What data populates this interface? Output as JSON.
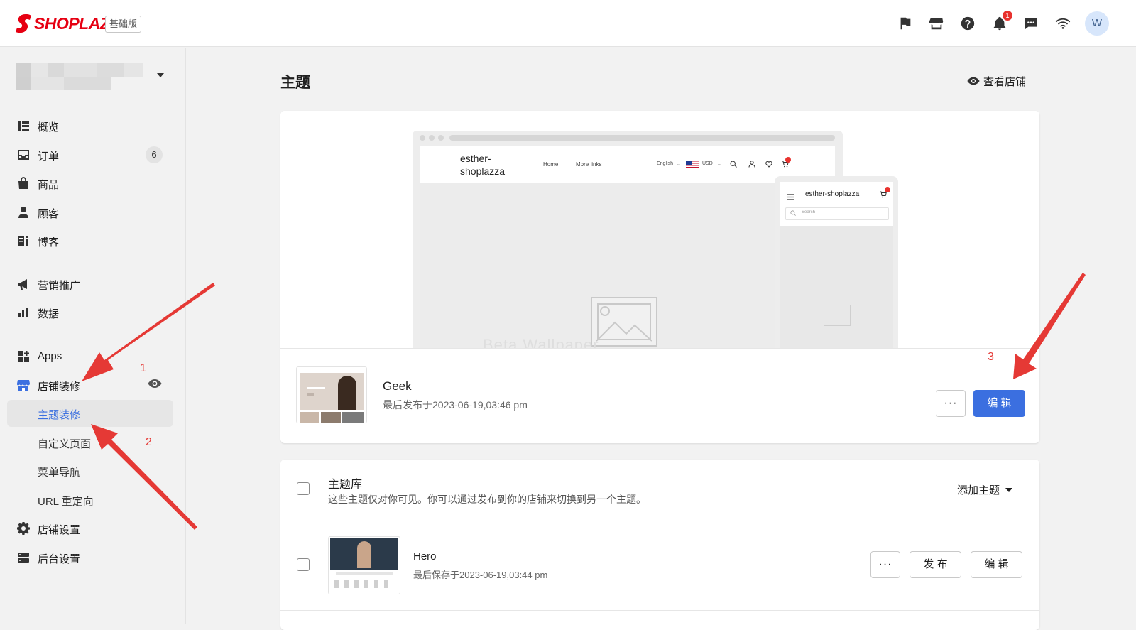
{
  "brand": {
    "name": "SHOPLAZZA",
    "plan": "基础版",
    "accent": "#e60012"
  },
  "topbar": {
    "icons": [
      "flag-icon",
      "store-icon",
      "help-icon",
      "bell-icon",
      "chat-icon",
      "wifi-icon"
    ],
    "notification_count": "1",
    "avatar_initial": "W"
  },
  "sidebar": {
    "store_name": "",
    "items": [
      {
        "label": "概览",
        "icon": "overview-icon"
      },
      {
        "label": "订单",
        "icon": "inbox-icon",
        "badge": "6"
      },
      {
        "label": "商品",
        "icon": "bag-icon"
      },
      {
        "label": "顾客",
        "icon": "person-icon"
      },
      {
        "label": "博客",
        "icon": "blog-icon"
      },
      {
        "label": "营销推广",
        "icon": "megaphone-icon"
      },
      {
        "label": "数据",
        "icon": "bar-chart-icon"
      },
      {
        "label": "Apps",
        "icon": "apps-icon"
      },
      {
        "label": "店铺装修",
        "icon": "storefront-icon"
      },
      {
        "label": "主题装修",
        "active": true
      },
      {
        "label": "自定义页面"
      },
      {
        "label": "菜单导航"
      },
      {
        "label": "URL 重定向"
      },
      {
        "label": "店铺设置",
        "icon": "gear-icon"
      },
      {
        "label": "后台设置",
        "icon": "server-icon"
      }
    ]
  },
  "main": {
    "title": "主题",
    "view_store": "查看店铺",
    "preview": {
      "store_brand_line1": "esther-",
      "store_brand_line2": "shoplazza",
      "nav_links": [
        "Home",
        "More links"
      ],
      "language": "English",
      "currency": "USD",
      "mobile_brand": "esther-shoplazza",
      "mobile_search_placeholder": "Search",
      "ghost_text": "Beta Wallpaper"
    },
    "current_theme": {
      "name": "Geek",
      "meta": "最后发布于2023-06-19,03:46 pm",
      "more_label": "···",
      "edit_label": "编 辑"
    },
    "library": {
      "title": "主题库",
      "description": "这些主题仅对你可见。你可以通过发布到你的店铺来切换到另一个主题。",
      "add_theme": "添加主题",
      "themes": [
        {
          "name": "Hero",
          "meta": "最后保存于2023-06-19,03:44 pm",
          "more_label": "···",
          "publish_label": "发 布",
          "edit_label": "编 辑"
        }
      ]
    }
  },
  "annotations": [
    "1",
    "2",
    "3"
  ],
  "colors": {
    "primary": "#3b6fe0",
    "annotation": "#e53935"
  }
}
